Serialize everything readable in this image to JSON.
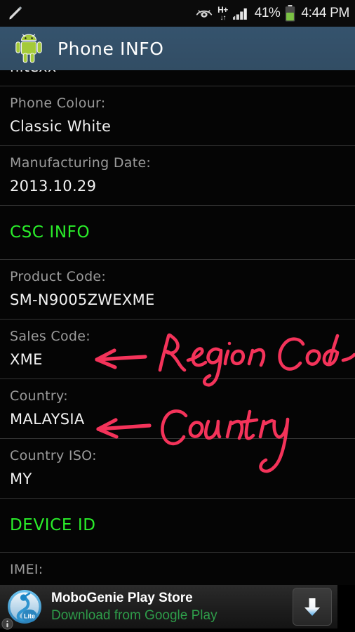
{
  "status_bar": {
    "edit_icon": "pencil-icon",
    "smart_stay_icon": "eye-icon",
    "network_type": "H+",
    "network_arrows": "↓↑",
    "signal_icon": "signal-bars-icon",
    "battery_percent": "41%",
    "battery_icon": "battery-icon",
    "time": "4:44 PM"
  },
  "app_bar": {
    "icon": "android-robot-icon",
    "title": "Phone INFO"
  },
  "list": {
    "clipped_top_value": "hltexx",
    "rows": [
      {
        "label": "Phone Colour:",
        "value": "Classic White"
      },
      {
        "label": "Manufacturing Date:",
        "value": "2013.10.29"
      }
    ],
    "section_csc": "CSC INFO",
    "csc_rows": [
      {
        "label": "Product Code:",
        "value": "SM-N9005ZWEXME"
      },
      {
        "label": "Sales Code:",
        "value": "XME"
      },
      {
        "label": "Country:",
        "value": "MALAYSIA"
      },
      {
        "label": "Country ISO:",
        "value": "MY"
      }
    ],
    "section_device": "DEVICE ID",
    "device_rows": [
      {
        "label": "IMEI:",
        "value": ""
      }
    ]
  },
  "annotations": [
    {
      "text": "Region Code",
      "target": "Sales Code value",
      "color": "#f4335a"
    },
    {
      "text": "Country",
      "target": "Country value",
      "color": "#f4335a"
    }
  ],
  "ad": {
    "title": "MoboGenie Play Store",
    "subtitle": "Download from Google Play",
    "logo_icon": "mobogenie-logo-icon",
    "logo_badge": "Lite",
    "download_icon": "download-arrow-icon",
    "adchoices_icon": "adchoices-info-icon"
  },
  "colors": {
    "header_bar": "#34506a",
    "section_green": "#2aee2a",
    "annotation_pink": "#f4335a",
    "label_gray": "#9b9b9b",
    "value_white": "#f2f2f2",
    "ad_green": "#2e9d4a"
  }
}
